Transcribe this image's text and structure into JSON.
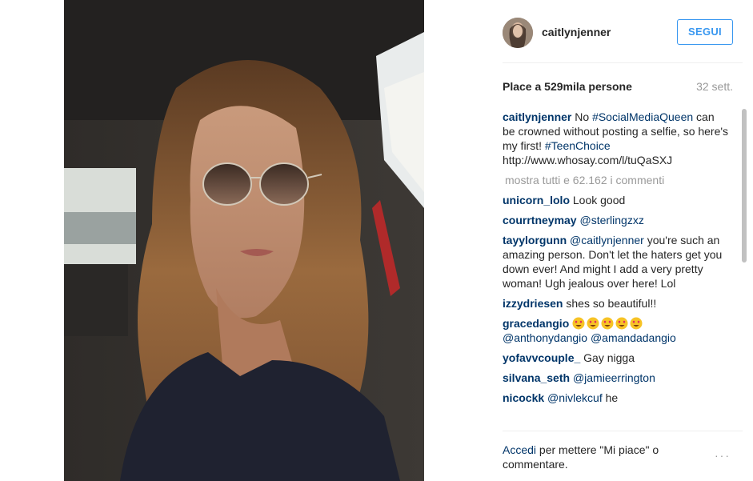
{
  "post": {
    "photo_alt": "selfie",
    "header": {
      "username": "caitlynjenner",
      "follow_label": "SEGUI"
    },
    "likes": {
      "prefix": "Place a",
      "count": "529mila persone",
      "time": "32 sett."
    },
    "caption": {
      "user": "caitlynjenner",
      "t1": " No ",
      "tag1": "#SocialMediaQueen",
      "t2": " can be crowned without posting a selfie, so here's my first! ",
      "tag2": "#TeenChoice",
      "t3": " http://www.whosay.com/l/tuQaSXJ"
    },
    "view_all": "mostra tutti e 62.162 i commenti",
    "comments": [
      {
        "user": "unicorn_lolo",
        "text": " Look good"
      },
      {
        "user": "courrtneymay",
        "mention": "@sterlingzxz"
      },
      {
        "user": "tayylorgunn",
        "mention": "@caitlynjenner",
        "text": " you're such an amazing person. Don't let the haters get you down ever! And might I add a very pretty woman! Ugh jealous over here! Lol"
      },
      {
        "user": "izzydriesen",
        "text": " shes so beautiful!!"
      },
      {
        "user": "gracedangio",
        "mention1": "@anthonydangio",
        "mention2": "@amandadangio",
        "emoji": "smiling-face-with-heart-eyes",
        "emoji_count": 5
      },
      {
        "user": "yofavvcouple_",
        "text": " Gay nigga"
      },
      {
        "user": "silvana_seth",
        "mention": "@jamieerrington"
      },
      {
        "user": "nicockk",
        "mention": "@nivlekcuf",
        "text": " he"
      }
    ],
    "footer": {
      "login_link": "Accedi",
      "login_rest": " per mettere \"Mi piace\" o commentare.",
      "more_icon": "···"
    }
  },
  "colors": {
    "link": "#003569",
    "accent": "#3897f0",
    "muted": "#999999",
    "text": "#262626"
  }
}
